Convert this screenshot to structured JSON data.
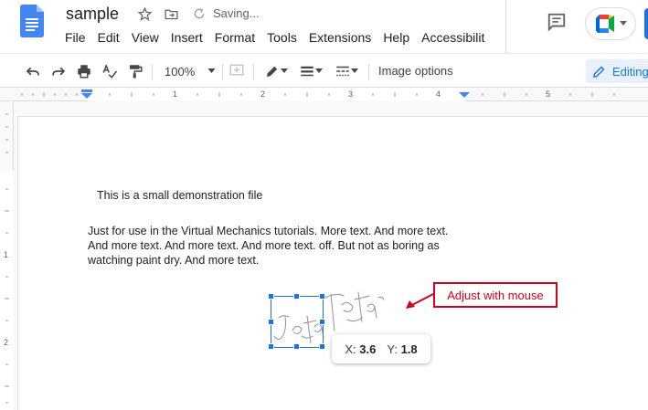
{
  "document": {
    "title": "sample",
    "status": "Saving..."
  },
  "menu": [
    "File",
    "Edit",
    "View",
    "Insert",
    "Format",
    "Tools",
    "Extensions",
    "Help",
    "Accessibilit"
  ],
  "toolbar": {
    "zoom": "100%",
    "image_options_label": "Image options",
    "editing_label": "Editing"
  },
  "ruler": {
    "numbers": [
      "1",
      "2",
      "3",
      "4",
      "5"
    ]
  },
  "vruler": {
    "numbers": [
      "1",
      "2"
    ]
  },
  "content": {
    "heading": "This is a small demonstration file",
    "body": "Just for use in the Virtual Mechanics tutorials. More text. And more text. And more text. And more text. And more text. off. But not as boring as watching paint dry. And more text."
  },
  "position_tooltip": {
    "x_label": "X:",
    "x_value": "3.6",
    "y_label": "Y:",
    "y_value": "1.8"
  },
  "annotation": {
    "text": "Adjust with mouse",
    "color": "#d0021b"
  },
  "colors": {
    "accent": "#1a73e8",
    "docs_blue": "#4285f4"
  }
}
